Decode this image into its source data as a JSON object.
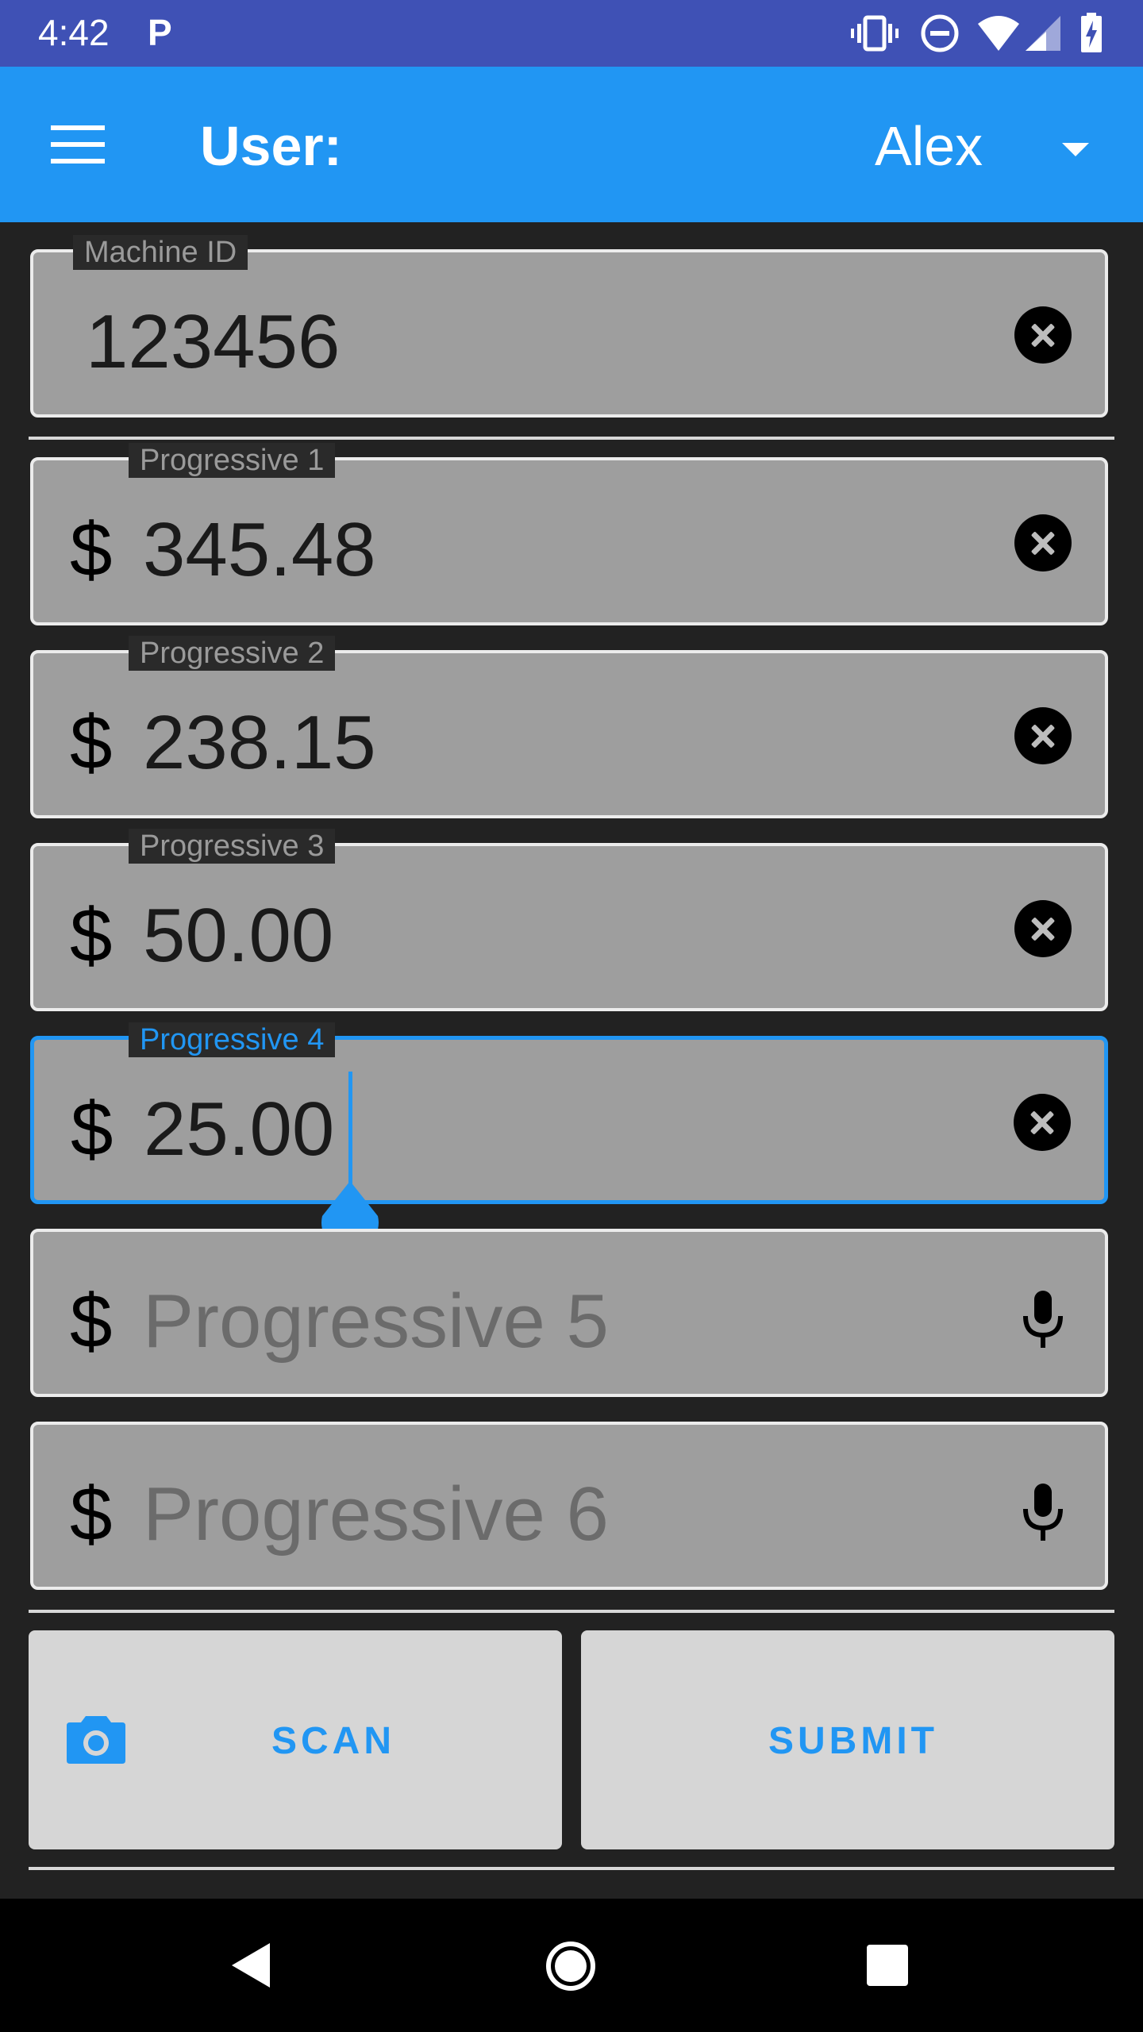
{
  "status_bar": {
    "time": "4:42",
    "notification_icon": "P"
  },
  "app_bar": {
    "user_label": "User:",
    "user_value": "Alex"
  },
  "fields": [
    {
      "label": "Machine ID",
      "value": "123456"
    },
    {
      "label": "Progressive 1",
      "prefix": "$",
      "value": "345.48"
    },
    {
      "label": "Progressive 2",
      "prefix": "$",
      "value": "238.15"
    },
    {
      "label": "Progressive 3",
      "prefix": "$",
      "value": "50.00"
    },
    {
      "label": "Progressive 4",
      "prefix": "$",
      "value": "25.00"
    },
    {
      "prefix": "$",
      "placeholder": "Progressive 5"
    },
    {
      "prefix": "$",
      "placeholder": "Progressive 6"
    }
  ],
  "buttons": {
    "scan": "SCAN",
    "submit": "SUBMIT"
  },
  "colors": {
    "accent": "#2196f3",
    "status_bar": "#3f51b5",
    "background": "#222222"
  }
}
